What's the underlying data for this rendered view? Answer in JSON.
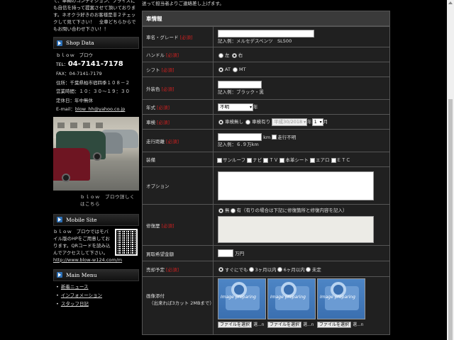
{
  "sidebar": {
    "intro_text": "て、車輌のコンディション、プライスにも自信を持って提案させて頂いております。ネオクラ好きのお客様是非２チェックして見て下さい！　全車どちらからでもお問い合わせ下さい！！",
    "shop_data": {
      "heading": "Shop Data",
      "name": "ｂｌｏｗ　ブロウ",
      "tel_prefix": "TEL：",
      "tel": "04-7141-7178",
      "fax": "FAX：04-7141-7179",
      "address": "住所：千葉県柏市宿四季１０８－２",
      "hours": "営業時間：１０：３０～１９：３０",
      "holiday": "定休日：年中無休",
      "email_label": "E-mail：",
      "email": "blow_hh@yahoo.co.jp",
      "photo_caption": "ｂｌｏｗ　ブロウ詳しくはこちら"
    },
    "mobile": {
      "heading": "Mobile Site",
      "text": "ｂｌｏｗ　ブロウではモバイル版のHPをご用意しております。QRコードを読み込んでアクセスして下さい。",
      "url": "http://www.blow-w124.com/m"
    },
    "main_menu": {
      "heading": "Main Menu",
      "items": [
        "新着ニュース",
        "インフォメーション",
        "スタッフ日記"
      ]
    }
  },
  "form": {
    "top_note": "送って担当者よりご連絡差し上げます。",
    "section_title": "車情報",
    "required": "[必須]",
    "car_name": {
      "label": "車名・グレード",
      "value": "",
      "example": "記入例：メルセデスベンツ　SL500"
    },
    "handle": {
      "label": "ハンドル",
      "options": [
        "左",
        "右"
      ],
      "selected": "右"
    },
    "shift": {
      "label": "シフト",
      "options": [
        "AT",
        "MT"
      ],
      "selected": "AT"
    },
    "color": {
      "label": "外装色",
      "value": "",
      "example": "記入例：ブラック・黒"
    },
    "year": {
      "label": "年式",
      "select": "不明",
      "suffix": "年"
    },
    "inspection": {
      "label": "車検",
      "options": [
        "車検無し",
        "車検有り"
      ],
      "selected": "車検無し",
      "year_select": "平成30/2018",
      "year_suffix": "年",
      "month_select": "1",
      "month_suffix": "月"
    },
    "mileage": {
      "label": "走行距離",
      "value": "",
      "unit": "km",
      "unknown_label": "走行不明",
      "example": "記入例：６.９万km"
    },
    "equipment": {
      "label": "装備",
      "options": [
        "サンルーフ",
        "ナビ",
        "ＴＶ",
        "本革シート",
        "エアロ",
        "ＥＴＣ"
      ]
    },
    "options": {
      "label": "オプション",
      "value": ""
    },
    "repair": {
      "label": "修復歴",
      "options": [
        "無",
        "有"
      ],
      "selected": "無",
      "note": "（有りの場合は下記に修復箇所と修復内容を記入）"
    },
    "price": {
      "label": "買取希望金額",
      "value": "",
      "unit": "万円"
    },
    "sale_plan": {
      "label": "売却予定",
      "options": [
        "すぐにでも",
        "3ヶ月以内",
        "6ヶ月以内",
        "未定"
      ],
      "selected": "すぐにでも"
    },
    "images": {
      "label": "画像添付",
      "sublabel": "（出来れば3カット 2MBまで）",
      "placeholder_text": "Image preparing",
      "file_button": "ファイルを選択",
      "file_status": "選...n"
    }
  },
  "colors": {
    "required": "#d02020",
    "background": "#000000",
    "accent": "#2c6fb5"
  }
}
